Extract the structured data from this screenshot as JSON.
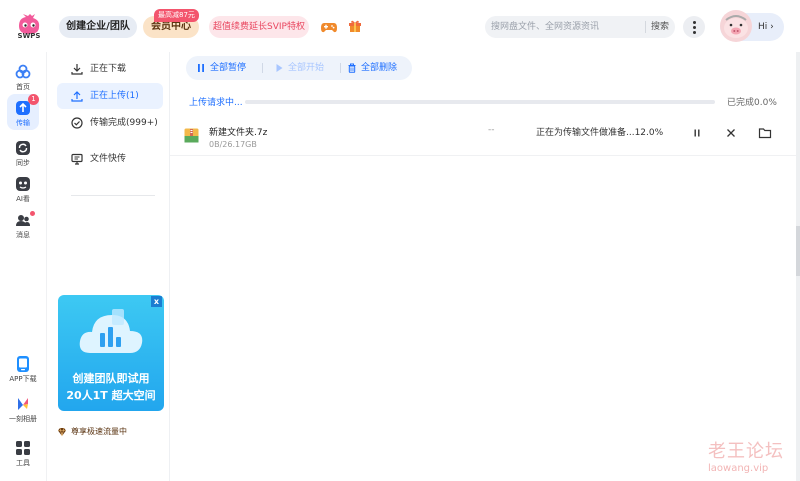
{
  "header": {
    "logo_text": "SWPS",
    "team_button": "创建企业/团队",
    "vip_button": "会员中心",
    "vip_badge": "最高减87元",
    "svip_button": "超值续费延长SVIP特权",
    "search_placeholder": "搜网盘文件、全网资源资讯",
    "search_button": "搜索",
    "greeting": "Hi",
    "greeting_arrow": "›"
  },
  "leftnav": {
    "items": [
      {
        "label": "首页",
        "icon": "cloud-home-icon"
      },
      {
        "label": "传输",
        "icon": "transfer-icon",
        "badge": "1"
      },
      {
        "label": "同步",
        "icon": "sync-icon"
      },
      {
        "label": "AI看",
        "icon": "ai-icon"
      },
      {
        "label": "消息",
        "icon": "message-icon"
      },
      {
        "label": "APP下载",
        "icon": "phone-icon"
      },
      {
        "label": "一刻相册",
        "icon": "album-icon"
      },
      {
        "label": "工具",
        "icon": "tools-icon"
      }
    ]
  },
  "subnav": {
    "items": [
      {
        "label": "正在下载",
        "icon": "download-icon"
      },
      {
        "label": "正在上传(1)",
        "icon": "upload-icon"
      },
      {
        "label": "传输完成(999+)",
        "icon": "check-circle-icon"
      },
      {
        "label": "文件快传",
        "icon": "monitor-icon"
      }
    ],
    "promo": {
      "line1": "创建团队即试用",
      "line2": "20人1T 超大空间",
      "close": "x"
    },
    "speed_text": "尊享极速流量中"
  },
  "main": {
    "toolbar": {
      "pause_all": "全部暂停",
      "start_all": "全部开始",
      "delete_all": "全部删除"
    },
    "status_text": "上传请求中...",
    "progress_label": "已完成0.0%",
    "progress": 0.0,
    "files": [
      {
        "name": "新建文件夹.7z",
        "size": "0B/26.17GB",
        "speed": "--",
        "status": "正在为传输文件做准备...12.0%"
      }
    ]
  },
  "watermark": {
    "line1": "老王论坛",
    "line2": "laowang.vip"
  },
  "colors": {
    "accent": "#1e6fff",
    "badge": "#f3556d",
    "svip_text": "#e9465f"
  }
}
